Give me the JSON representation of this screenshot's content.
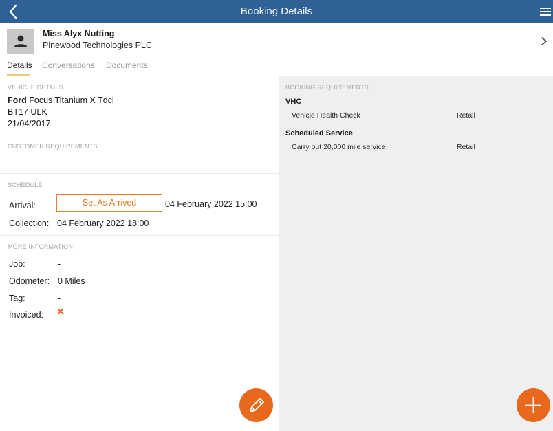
{
  "header": {
    "title": "Booking Details"
  },
  "customer": {
    "name": "Miss Alyx Nutting",
    "company": "Pinewood Technologies PLC"
  },
  "tabs": [
    {
      "label": "Details",
      "active": true
    },
    {
      "label": "Conversations",
      "active": false
    },
    {
      "label": "Documents",
      "active": false
    }
  ],
  "vehicle": {
    "heading": "VEHICLE DETAILS",
    "make": "Ford",
    "model": "Focus Titanium X Tdci",
    "registration": "BT17 ULK",
    "date": "21/04/2017"
  },
  "customer_requirements": {
    "heading": "CUSTOMER REQUIREMENTS"
  },
  "schedule": {
    "heading": "SCHEDULE",
    "arrival_label": "Arrival:",
    "arrive_button": "Set As Arrived",
    "arrival_value": "04 February 2022 15:00",
    "collection_label": "Collection:",
    "collection_value": "04 February 2022 18:00"
  },
  "more_info": {
    "heading": "MORE INFORMATION",
    "job_label": "Job:",
    "job_value": "-",
    "odometer_label": "Odometer:",
    "odometer_value": "0 Miles",
    "tag_label": "Tag:",
    "tag_value": "-",
    "invoiced_label": "Invoiced:",
    "invoiced_icon": "cross-icon"
  },
  "booking_requirements": {
    "heading": "BOOKING REQUIREMENTS",
    "groups": [
      {
        "title": "VHC",
        "item": "Vehicle Health Check",
        "type": "Retail"
      },
      {
        "title": "Scheduled Service",
        "item": "Carry out 20,000 mile service",
        "type": "Retail"
      }
    ]
  },
  "colors": {
    "header_bg": "#2f6196",
    "accent": "#e8691d"
  },
  "icons": {
    "back": "back-arrow-icon",
    "menu": "hamburger-menu-icon",
    "edit": "pencil-icon",
    "add": "plus-icon"
  }
}
